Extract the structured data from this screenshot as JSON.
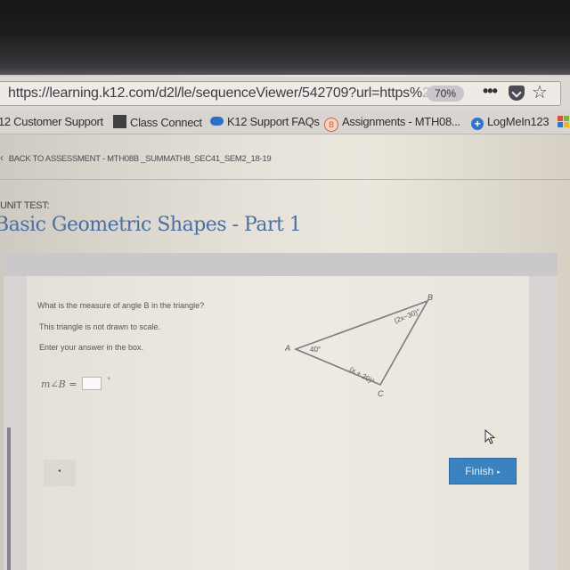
{
  "browser": {
    "url": "https://learning.k12.com/d2l/le/sequenceViewer/542709?url=https%",
    "url_faded_tail": "2",
    "zoom_level": "70%",
    "more_icon": "more-icon",
    "pocket_icon": "pocket-icon",
    "bookmark_star_icon": "star-icon"
  },
  "bookmarks": [
    {
      "label": "12 Customer Support",
      "icon": ""
    },
    {
      "label": "Class Connect",
      "icon": "square-icon"
    },
    {
      "label": "K12 Support FAQs",
      "icon": "cloud-icon"
    },
    {
      "label": "Assignments - MTH08...",
      "icon": "brightspace-icon",
      "glyph": "B"
    },
    {
      "label": "LogMeIn123",
      "icon": "plus-icon",
      "glyph": "+"
    }
  ],
  "page": {
    "back_chevron": "‹",
    "back_link": "BACK TO ASSESSMENT - MTH08B _SUMMATH8_SEC41_SEM2_18-19",
    "unit_label": "UNIT TEST:",
    "title": "Basic Geometric Shapes - Part 1"
  },
  "question": {
    "prompt": "What is the measure of angle B in the triangle?",
    "note": "This triangle is not drawn to scale.",
    "instruction": "Enter your answer in the box.",
    "answer_label": "m∠B =",
    "answer_value": "",
    "answer_unit": "°",
    "triangle": {
      "vertices": [
        "A",
        "B",
        "C"
      ],
      "angle_A": "40°",
      "angle_B": "(2x−30)°",
      "angle_C": "(x + 20)°"
    }
  },
  "navigation": {
    "prev_glyph": "◂",
    "finish_label": "Finish",
    "finish_arrow": "▸",
    "finish_color": "#3b83c0"
  }
}
